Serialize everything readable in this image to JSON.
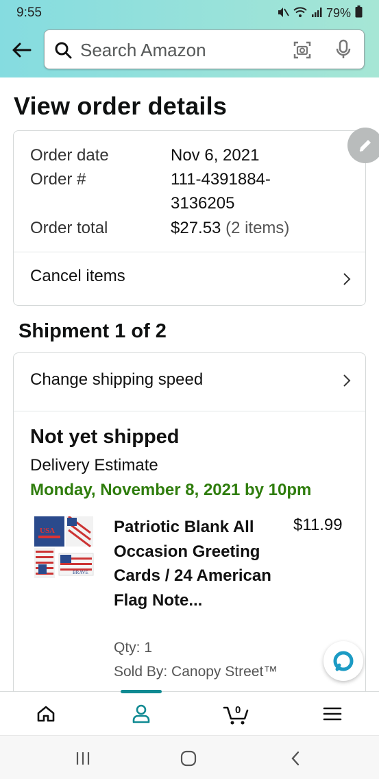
{
  "status_bar": {
    "time": "9:55",
    "battery": "79%"
  },
  "search": {
    "placeholder": "Search Amazon"
  },
  "page": {
    "title": "View order details"
  },
  "order": {
    "date_label": "Order date",
    "date_value": "Nov 6, 2021",
    "number_label": "Order #",
    "number_value_line1": "111-4391884-",
    "number_value_line2": "3136205",
    "total_label": "Order total",
    "total_value": "$27.53",
    "total_items": "(2 items)",
    "cancel_label": "Cancel items"
  },
  "shipment": {
    "title": "Shipment 1 of 2",
    "change_speed_label": "Change shipping speed",
    "status": "Not yet shipped",
    "delivery_label": "Delivery Estimate",
    "delivery_date": "Monday, November 8, 2021 by 10pm",
    "item": {
      "title": "Patriotic Blank All Occasion Greeting Cards / 24 American Flag Note...",
      "price": "$11.99",
      "qty": "Qty: 1",
      "seller": "Sold By: Canopy Street™",
      "thumb_text_1": "USA",
      "thumb_text_2": "BRAVE"
    }
  },
  "bottom_nav": {
    "cart_count": "0",
    "active": "account"
  },
  "colors": {
    "header_start": "#85dce0",
    "header_end": "#a6e6d5",
    "delivery_green": "#2f7d0d",
    "active_teal": "#108a92"
  }
}
